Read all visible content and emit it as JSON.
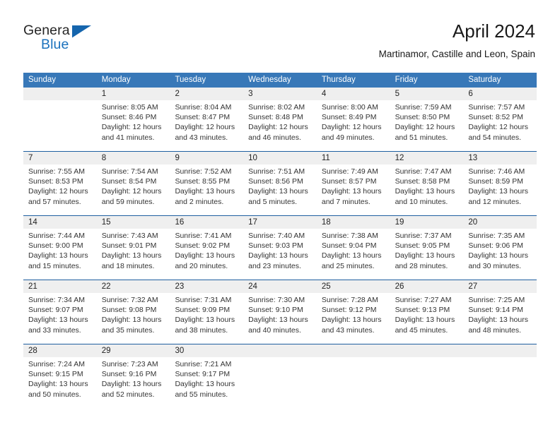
{
  "brand": {
    "name_part1": "General",
    "name_part2": "Blue",
    "logo_icon": "triangle-logo-icon",
    "accent_color": "#1565ad"
  },
  "header": {
    "title": "April 2024",
    "subtitle": "Martinamor, Castille and Leon, Spain"
  },
  "colors": {
    "weekday_header_bg": "#3878b8",
    "week_divider": "#1f5fa0",
    "day_band_bg": "#efefef",
    "text": "#333333"
  },
  "weekdays": [
    "Sunday",
    "Monday",
    "Tuesday",
    "Wednesday",
    "Thursday",
    "Friday",
    "Saturday"
  ],
  "weeks": [
    [
      {
        "day": "",
        "lines": []
      },
      {
        "day": "1",
        "lines": [
          "Sunrise: 8:05 AM",
          "Sunset: 8:46 PM",
          "Daylight: 12 hours",
          "and 41 minutes."
        ]
      },
      {
        "day": "2",
        "lines": [
          "Sunrise: 8:04 AM",
          "Sunset: 8:47 PM",
          "Daylight: 12 hours",
          "and 43 minutes."
        ]
      },
      {
        "day": "3",
        "lines": [
          "Sunrise: 8:02 AM",
          "Sunset: 8:48 PM",
          "Daylight: 12 hours",
          "and 46 minutes."
        ]
      },
      {
        "day": "4",
        "lines": [
          "Sunrise: 8:00 AM",
          "Sunset: 8:49 PM",
          "Daylight: 12 hours",
          "and 49 minutes."
        ]
      },
      {
        "day": "5",
        "lines": [
          "Sunrise: 7:59 AM",
          "Sunset: 8:50 PM",
          "Daylight: 12 hours",
          "and 51 minutes."
        ]
      },
      {
        "day": "6",
        "lines": [
          "Sunrise: 7:57 AM",
          "Sunset: 8:52 PM",
          "Daylight: 12 hours",
          "and 54 minutes."
        ]
      }
    ],
    [
      {
        "day": "7",
        "lines": [
          "Sunrise: 7:55 AM",
          "Sunset: 8:53 PM",
          "Daylight: 12 hours",
          "and 57 minutes."
        ]
      },
      {
        "day": "8",
        "lines": [
          "Sunrise: 7:54 AM",
          "Sunset: 8:54 PM",
          "Daylight: 12 hours",
          "and 59 minutes."
        ]
      },
      {
        "day": "9",
        "lines": [
          "Sunrise: 7:52 AM",
          "Sunset: 8:55 PM",
          "Daylight: 13 hours",
          "and 2 minutes."
        ]
      },
      {
        "day": "10",
        "lines": [
          "Sunrise: 7:51 AM",
          "Sunset: 8:56 PM",
          "Daylight: 13 hours",
          "and 5 minutes."
        ]
      },
      {
        "day": "11",
        "lines": [
          "Sunrise: 7:49 AM",
          "Sunset: 8:57 PM",
          "Daylight: 13 hours",
          "and 7 minutes."
        ]
      },
      {
        "day": "12",
        "lines": [
          "Sunrise: 7:47 AM",
          "Sunset: 8:58 PM",
          "Daylight: 13 hours",
          "and 10 minutes."
        ]
      },
      {
        "day": "13",
        "lines": [
          "Sunrise: 7:46 AM",
          "Sunset: 8:59 PM",
          "Daylight: 13 hours",
          "and 12 minutes."
        ]
      }
    ],
    [
      {
        "day": "14",
        "lines": [
          "Sunrise: 7:44 AM",
          "Sunset: 9:00 PM",
          "Daylight: 13 hours",
          "and 15 minutes."
        ]
      },
      {
        "day": "15",
        "lines": [
          "Sunrise: 7:43 AM",
          "Sunset: 9:01 PM",
          "Daylight: 13 hours",
          "and 18 minutes."
        ]
      },
      {
        "day": "16",
        "lines": [
          "Sunrise: 7:41 AM",
          "Sunset: 9:02 PM",
          "Daylight: 13 hours",
          "and 20 minutes."
        ]
      },
      {
        "day": "17",
        "lines": [
          "Sunrise: 7:40 AM",
          "Sunset: 9:03 PM",
          "Daylight: 13 hours",
          "and 23 minutes."
        ]
      },
      {
        "day": "18",
        "lines": [
          "Sunrise: 7:38 AM",
          "Sunset: 9:04 PM",
          "Daylight: 13 hours",
          "and 25 minutes."
        ]
      },
      {
        "day": "19",
        "lines": [
          "Sunrise: 7:37 AM",
          "Sunset: 9:05 PM",
          "Daylight: 13 hours",
          "and 28 minutes."
        ]
      },
      {
        "day": "20",
        "lines": [
          "Sunrise: 7:35 AM",
          "Sunset: 9:06 PM",
          "Daylight: 13 hours",
          "and 30 minutes."
        ]
      }
    ],
    [
      {
        "day": "21",
        "lines": [
          "Sunrise: 7:34 AM",
          "Sunset: 9:07 PM",
          "Daylight: 13 hours",
          "and 33 minutes."
        ]
      },
      {
        "day": "22",
        "lines": [
          "Sunrise: 7:32 AM",
          "Sunset: 9:08 PM",
          "Daylight: 13 hours",
          "and 35 minutes."
        ]
      },
      {
        "day": "23",
        "lines": [
          "Sunrise: 7:31 AM",
          "Sunset: 9:09 PM",
          "Daylight: 13 hours",
          "and 38 minutes."
        ]
      },
      {
        "day": "24",
        "lines": [
          "Sunrise: 7:30 AM",
          "Sunset: 9:10 PM",
          "Daylight: 13 hours",
          "and 40 minutes."
        ]
      },
      {
        "day": "25",
        "lines": [
          "Sunrise: 7:28 AM",
          "Sunset: 9:12 PM",
          "Daylight: 13 hours",
          "and 43 minutes."
        ]
      },
      {
        "day": "26",
        "lines": [
          "Sunrise: 7:27 AM",
          "Sunset: 9:13 PM",
          "Daylight: 13 hours",
          "and 45 minutes."
        ]
      },
      {
        "day": "27",
        "lines": [
          "Sunrise: 7:25 AM",
          "Sunset: 9:14 PM",
          "Daylight: 13 hours",
          "and 48 minutes."
        ]
      }
    ],
    [
      {
        "day": "28",
        "lines": [
          "Sunrise: 7:24 AM",
          "Sunset: 9:15 PM",
          "Daylight: 13 hours",
          "and 50 minutes."
        ]
      },
      {
        "day": "29",
        "lines": [
          "Sunrise: 7:23 AM",
          "Sunset: 9:16 PM",
          "Daylight: 13 hours",
          "and 52 minutes."
        ]
      },
      {
        "day": "30",
        "lines": [
          "Sunrise: 7:21 AM",
          "Sunset: 9:17 PM",
          "Daylight: 13 hours",
          "and 55 minutes."
        ]
      },
      {
        "day": "",
        "lines": []
      },
      {
        "day": "",
        "lines": []
      },
      {
        "day": "",
        "lines": []
      },
      {
        "day": "",
        "lines": []
      }
    ]
  ]
}
